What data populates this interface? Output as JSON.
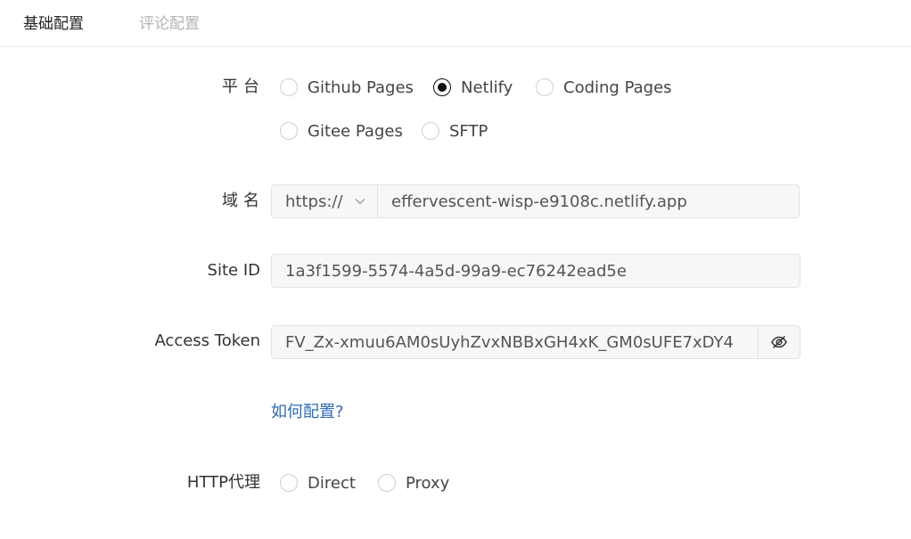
{
  "tabs": [
    {
      "label": "基础配置",
      "active": true
    },
    {
      "label": "评论配置",
      "active": false
    }
  ],
  "form": {
    "platform": {
      "label": "平台",
      "options": [
        "Github Pages",
        "Netlify",
        "Coding Pages",
        "Gitee Pages",
        "SFTP"
      ],
      "selected": "Netlify"
    },
    "domain": {
      "label": "域名",
      "protocol": "https://",
      "value": "effervescent-wisp-e9108c.netlify.app"
    },
    "site_id": {
      "label": "Site ID",
      "value": "1a3f1599-5574-4a5d-99a9-ec76242ead5e"
    },
    "access_token": {
      "label": "Access Token",
      "value": "FV_Zx-xmuu6AM0sUyhZvxNBBxGH4xK_GM0sUFE7xDY4",
      "toggle_icon": "eye-slash-icon"
    },
    "help_link": "如何配置?",
    "http_proxy": {
      "label": "HTTP代理",
      "options": [
        "Direct",
        "Proxy"
      ],
      "selected": ""
    }
  }
}
